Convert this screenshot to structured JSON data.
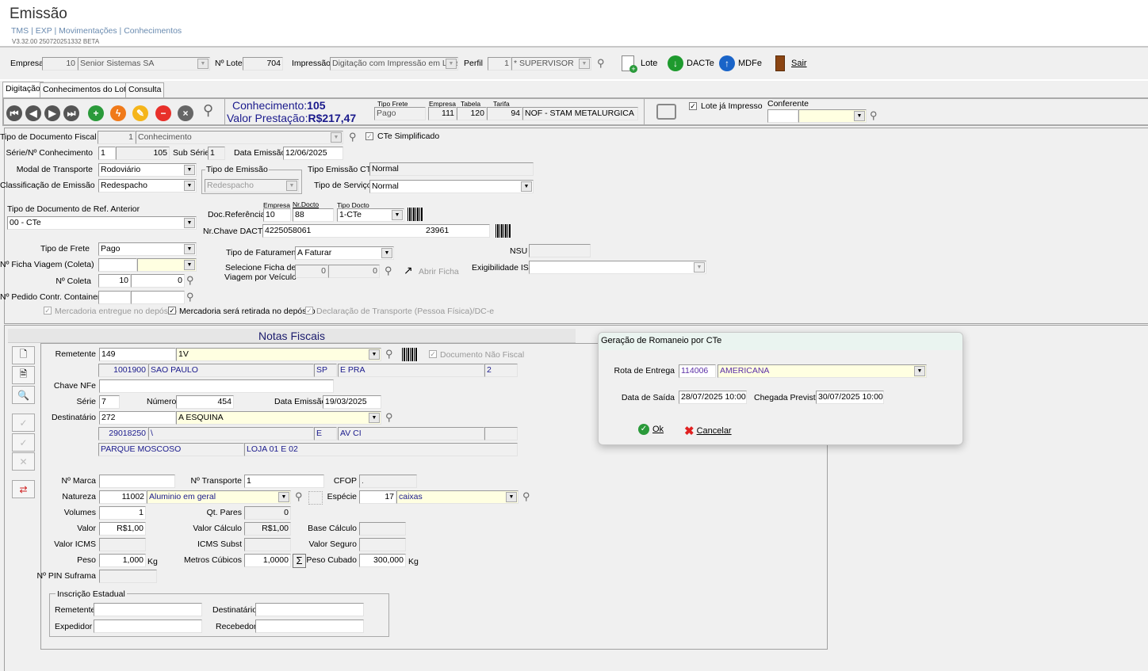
{
  "header": {
    "title": "Emissão",
    "breadcrumb": "TMS | EXP | Movimentações | Conhecimentos",
    "version": "V3.32.00 250720251332 BETA"
  },
  "toolbar": {
    "empresa_label": "Empresa",
    "empresa_code": "10",
    "empresa_name": "Senior Sistemas SA",
    "lote_label": "Nº Lote",
    "lote_value": "704",
    "impressao_label": "Impressão",
    "impressao_value": "Digitação com Impressão em Lote",
    "perfil_label": "Perfil",
    "perfil_code": "1",
    "perfil_name": "* SUPERVISOR",
    "btn_lote": "Lote",
    "btn_dacte": "DACTe",
    "btn_mdfe": "MDFe",
    "btn_sair": "Sair"
  },
  "tabs": [
    "Digitação",
    "Conhecimentos do Lote",
    "Consulta"
  ],
  "nav": {
    "conhecimento_label": "Conhecimento:",
    "conhecimento_value": "105",
    "valor_label": "Valor Prestação:",
    "valor_value": "R$217,47",
    "tipo_frete_label": "Tipo Frete",
    "tipo_frete": "Pago",
    "empresa_label": "Empresa",
    "empresa": "111",
    "tabela_label": "Tabela",
    "tabela": "120",
    "tarifa_label": "Tarifa",
    "tarifa": "94",
    "tarifa_name": "NOF - STAM METALURGICA",
    "lote_impresso": "Lote já Impresso",
    "conferente_label": "Conferente"
  },
  "form": {
    "tipo_doc_label": "Tipo de Documento Fiscal",
    "tipo_doc_code": "1",
    "tipo_doc": "Conhecimento",
    "cte_simplificado": "CTe Simplificado",
    "serie_label": "Série/Nº Conhecimento",
    "serie": "1",
    "numero": "105",
    "sub_serie_label": "Sub Série",
    "sub_serie": "1",
    "data_emissao_label": "Data Emissão",
    "data_emissao": "12/06/2025",
    "modal_label": "Modal de Transporte",
    "modal": "Rodoviário",
    "tipo_emissao_group": "Tipo de Emissão",
    "tipo_emissao": "Redespacho",
    "tipo_emissao_cte_label": "Tipo Emissão CTe",
    "tipo_emissao_cte": "Normal",
    "classificacao_label": "Classificação de Emissão",
    "classificacao": "Redespacho",
    "tipo_servico_label": "Tipo de Serviço",
    "tipo_servico": "Normal",
    "ref_anterior_label": "Tipo de Documento de Ref. Anterior",
    "ref_anterior": "00 - CTe",
    "docref_empresa_label": "Empresa",
    "docref_nrdocto_label": "Nr.Docto",
    "docref_tipo_label": "Tipo Docto",
    "docref_label": "Doc.Referência",
    "docref_empresa": "10",
    "docref_nrdocto": "88",
    "docref_tipo": "1-CTe",
    "chave_dacte_label": "Nr.Chave DACTE",
    "chave_dacte_start": "4225058061",
    "chave_dacte_end": "23961",
    "tipo_frete_label": "Tipo de Frete",
    "tipo_frete": "Pago",
    "tipo_faturamento_label": "Tipo de Faturamento",
    "tipo_faturamento": "A Faturar",
    "nsu_label": "NSU",
    "ficha_viagem_label": "Nº Ficha Viagem (Coleta)",
    "selecione_ficha_label1": "Selecione Ficha de",
    "selecione_ficha_label2": "Viagem por Veículo",
    "ficha_a": "0",
    "ficha_b": "0",
    "abrir_ficha": "Abrir Ficha",
    "exigibilidade_label": "Exigibilidade ISS",
    "coleta_label": "Nº Coleta",
    "coleta_a": "10",
    "coleta_b": "0",
    "pedido_label": "Nº Pedido Contr. Container",
    "chk_entregue": "Mercadoria entregue no depósito",
    "chk_retirada": "Mercadoria será retirada no depósito",
    "chk_declaracao": "Declaração de Transporte (Pessoa Física)/DC-e"
  },
  "notas": {
    "title": "Notas Fiscais",
    "remetente_label": "Remetente",
    "remetente_code": "149",
    "remetente_name": "1V",
    "doc_nao_fiscal": "Documento Não Fiscal",
    "rem_cep": "1001900",
    "rem_cidade": "SAO PAULO",
    "rem_uf": "SP",
    "rem_end": "E PRA",
    "rem_num": "2",
    "chave_nfe_label": "Chave NFe",
    "serie_label": "Série",
    "serie": "7",
    "numero_label": "Número",
    "numero": "454",
    "data_emissao_label": "Data Emissão",
    "data_emissao": "19/03/2025",
    "destinatario_label": "Destinatário",
    "dest_code": "272",
    "dest_name": "A ESQUINA",
    "dest_cep": "29018250",
    "dest_cidade": "\\",
    "dest_uf": "E",
    "dest_end": "AV CI",
    "dest_num": "",
    "dest_bairro": "PARQUE MOSCOSO",
    "dest_compl": "LOJA 01 E 02",
    "marca_label": "Nº Marca",
    "transporte_label": "Nº Transporte",
    "transporte": "1",
    "cfop_label": "CFOP",
    "cfop": ".",
    "natureza_label": "Natureza",
    "natureza_code": "11002",
    "natureza": "Aluminio em geral",
    "especie_label": "Espécie",
    "especie_code": "17",
    "especie": "caixas",
    "volumes_label": "Volumes",
    "volumes": "1",
    "qt_pares_label": "Qt. Pares",
    "qt_pares": "0",
    "valor_label": "Valor",
    "valor": "R$1,00",
    "valor_calculo_label": "Valor Cálculo",
    "valor_calculo": "R$1,00",
    "base_calculo_label": "Base Cálculo",
    "valor_icms_label": "Valor ICMS",
    "icms_subst_label": "ICMS Subst",
    "valor_seguro_label": "Valor Seguro",
    "peso_label": "Peso",
    "peso": "1,000",
    "kg": "Kg",
    "metros_label": "Metros Cúbicos",
    "metros": "1,0000",
    "peso_cubado_label": "Peso Cubado",
    "peso_cubado": "300,000",
    "pin_label": "Nº PIN Suframa",
    "ie_group": "Inscrição Estadual",
    "ie_remetente": "Remetente",
    "ie_destinatario": "Destinatário",
    "ie_expedidor": "Expedidor",
    "ie_recebedor": "Recebedor"
  },
  "dialog": {
    "title": "Geração de Romaneio por CTe",
    "rota_label": "Rota de Entrega",
    "rota_code": "114006",
    "rota_name": "AMERICANA",
    "saida_label": "Data de Saída",
    "saida": "28/07/2025 10:00",
    "chegada_label": "Chegada Prevista",
    "chegada": "30/07/2025 10:00",
    "ok": "Ok",
    "cancelar": "Cancelar"
  }
}
